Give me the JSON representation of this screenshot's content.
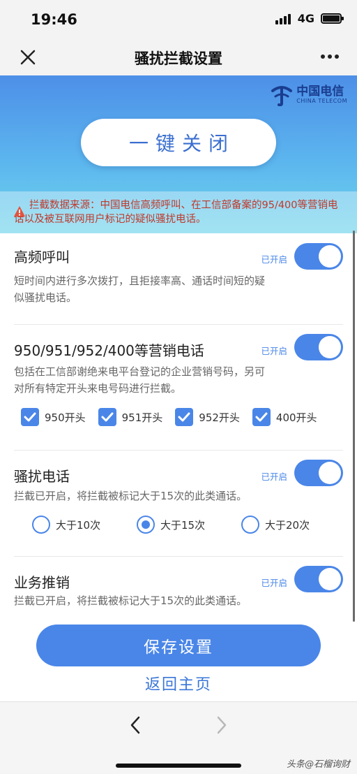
{
  "status": {
    "time": "19:46",
    "network": "4G"
  },
  "nav": {
    "title": "骚扰拦截设置"
  },
  "banner": {
    "brand_cn": "中国电信",
    "brand_en": "CHINA TELECOM",
    "oneclick_label": "一键关闭",
    "notice": "拦截数据来源：中国电信高频呼叫、在工信部备案的95/400等营销电话以及被互联网用户标记的疑似骚扰电话。"
  },
  "sections": [
    {
      "title": "高频呼叫",
      "status": "已开启",
      "desc": "短时间内进行多次拨打，且拒接率高、通话时间短的疑似骚扰电话。"
    },
    {
      "title": "950/951/952/400等营销电话",
      "status": "已开启",
      "desc": "包括在工信部谢绝来电平台登记的企业营销号码，另可对所有特定开头来电号码进行拦截。",
      "checks": [
        "950开头",
        "951开头",
        "952开头",
        "400开头"
      ]
    },
    {
      "title": "骚扰电话",
      "status": "已开启",
      "desc": "拦截已开启，将拦截被标记大于15次的此类通话。",
      "radios": [
        "大于10次",
        "大于15次",
        "大于20次"
      ],
      "radio_selected": "大于15次"
    },
    {
      "title": "业务推销",
      "status": "已开启",
      "desc": "拦截已开启，将拦截被标记大于15次的此类通话。"
    }
  ],
  "actions": {
    "save_label": "保存设置",
    "home_label": "返回主页"
  },
  "footer": {
    "watermark": "头条@石榴询财"
  },
  "colors": {
    "accent": "#4a86e8",
    "notice": "#c0392b"
  }
}
